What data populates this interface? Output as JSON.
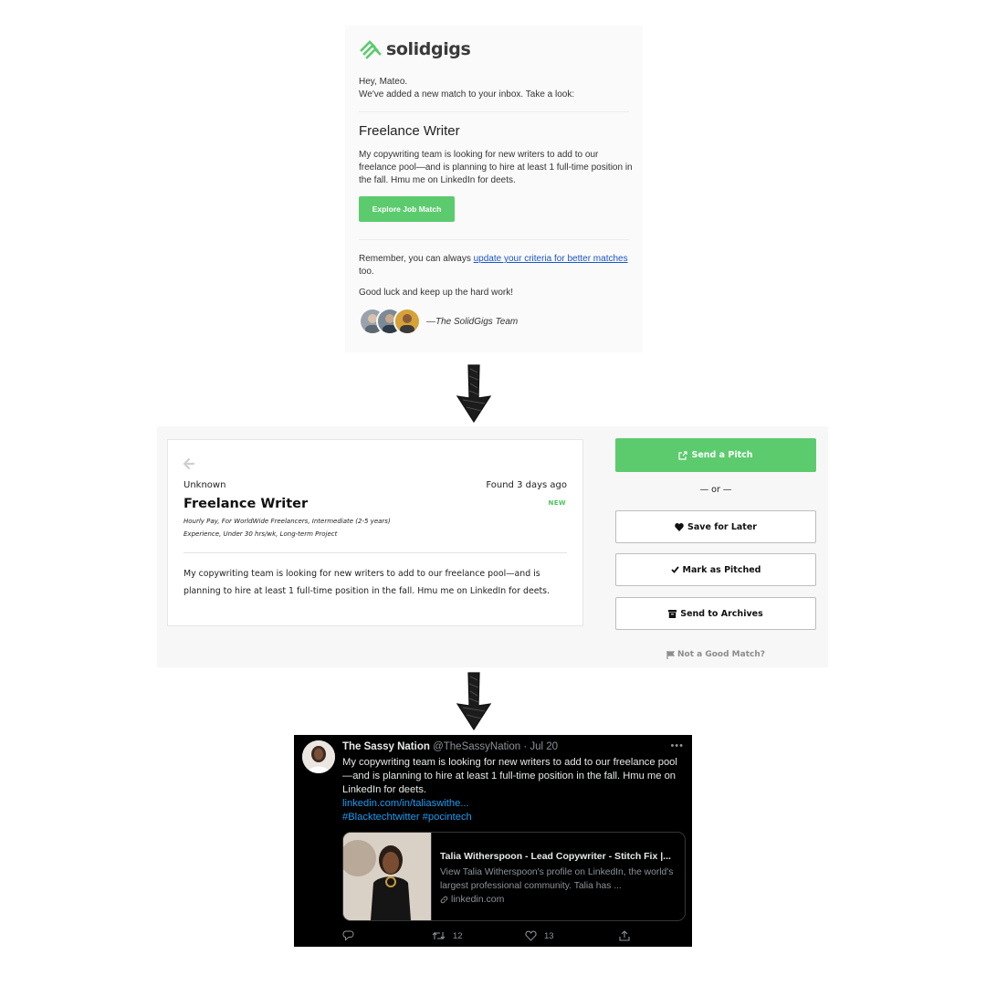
{
  "email": {
    "brand": "solidgigs",
    "greeting": "Hey, Mateo.",
    "intro": "We've added a new match to your inbox. Take a look:",
    "job_title": "Freelance Writer",
    "description": "My copywriting team is looking for new writers to add to our freelance pool—and is planning to hire at least 1 full-time position in the fall. Hmu me on LinkedIn for deets.",
    "explore_button": "Explore Job Match",
    "remember_prefix": "Remember, you can always",
    "remember_link": "update your criteria for better matches",
    "remember_suffix": "too.",
    "good_luck": "Good luck and keep up the hard work!",
    "signature": "—The SolidGigs Team",
    "brand_color": "#5ccb6e",
    "link_color": "#1a55c8"
  },
  "job_card": {
    "company": "Unknown",
    "found": "Found 3 days ago",
    "title": "Freelance Writer",
    "badge": "NEW",
    "meta_line1": "Hourly Pay, For WorldWide Freelancers, Intermediate (2-5 years)",
    "meta_line2": "Experience, Under 30 hrs/wk, Long-term Project",
    "description": "My copywriting team is looking for new writers to add to our freelance pool—and is planning to hire at least 1 full-time position in the fall. Hmu me on LinkedIn for deets."
  },
  "actions": {
    "send_pitch": "Send a Pitch",
    "or": "— or —",
    "save_later": "Save for Later",
    "mark_pitched": "Mark as Pitched",
    "send_archives": "Send to Archives",
    "not_good_match": "Not a Good Match?"
  },
  "tweet": {
    "name": "The Sassy Nation",
    "handle": "@TheSassyNation",
    "date": "· Jul 20",
    "text": "My copywriting team is looking for new writers to add to our freelance pool—and is planning to hire at least 1 full-time position in the fall. Hmu me on LinkedIn for deets.",
    "link": "linkedin.com/in/taliaswithe...",
    "hashtags": "#Blacktechtwitter #pocintech",
    "card_title": "Talia Witherspoon - Lead Copywriter - Stitch Fix |...",
    "card_description": "View Talia Witherspoon's profile on LinkedIn, the world's largest professional community. Talia has ...",
    "card_domain": "linkedin.com",
    "retweets": "12",
    "likes": "13",
    "link_color": "#1d9bf0"
  }
}
